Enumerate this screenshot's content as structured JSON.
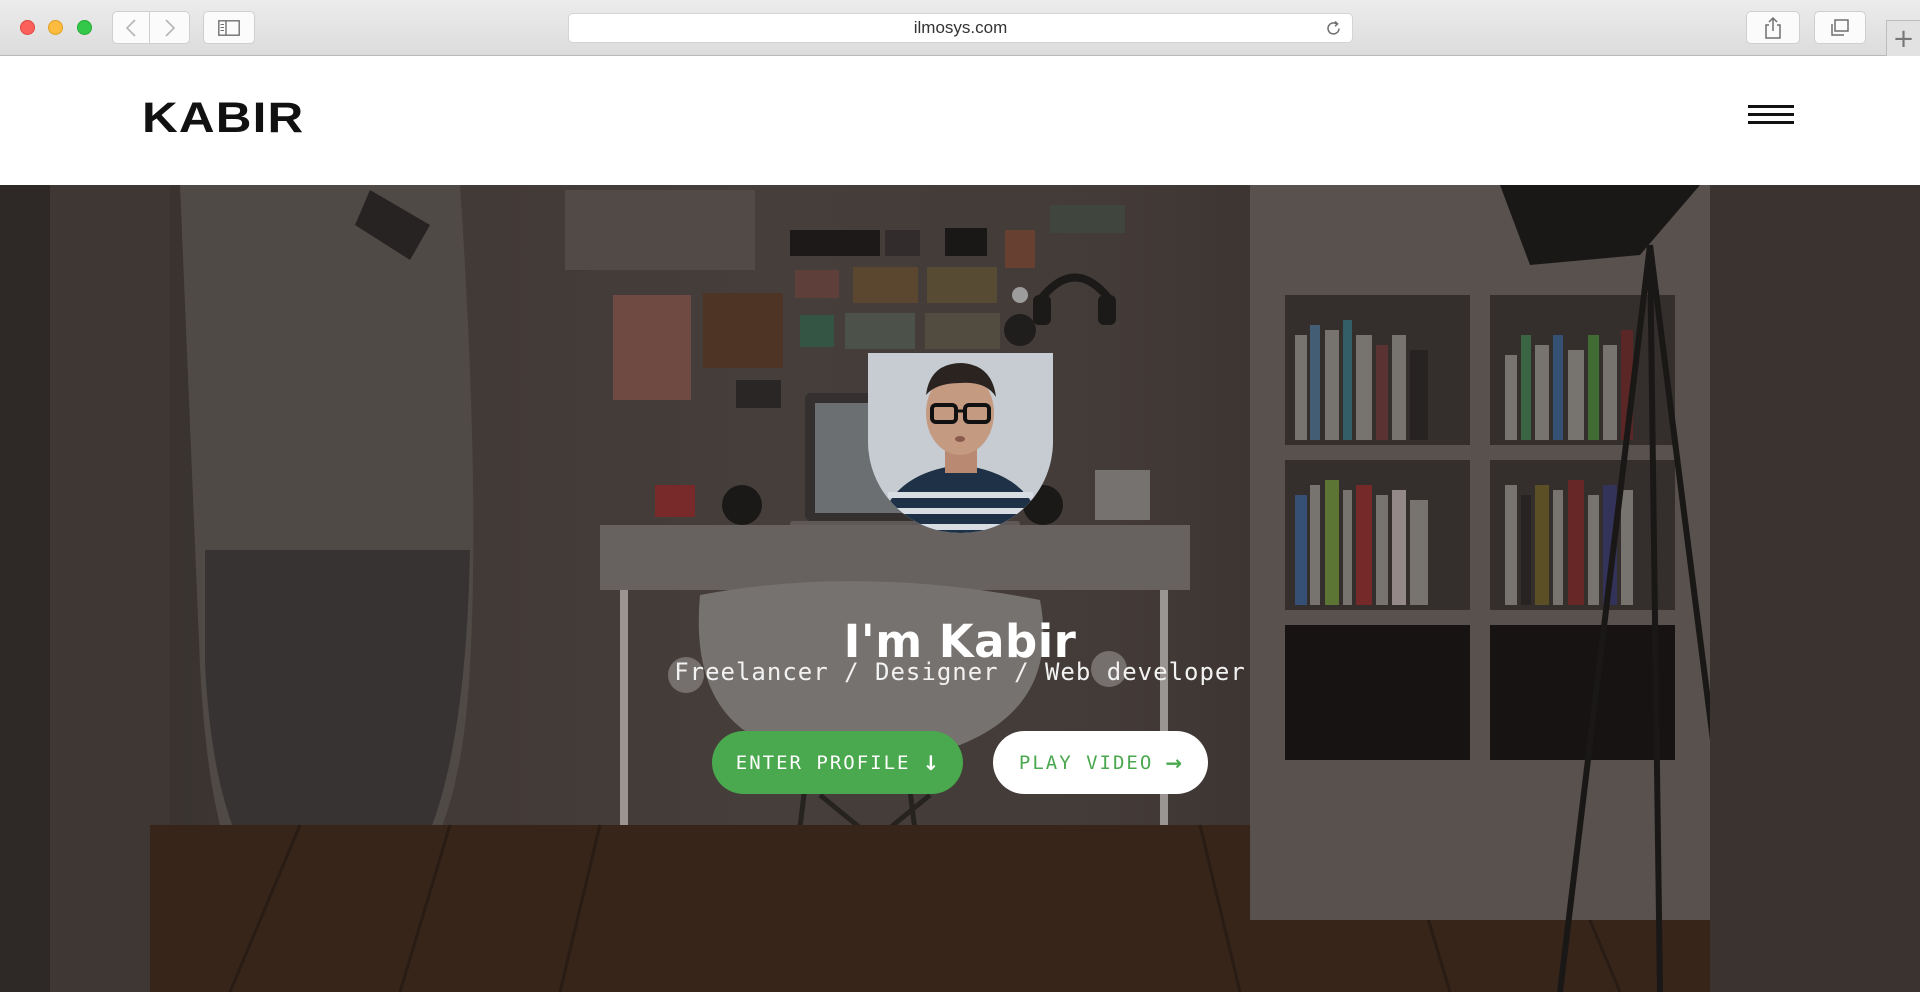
{
  "browser": {
    "url": "ilmosys.com"
  },
  "site": {
    "brand": "KABIR"
  },
  "hero": {
    "title": "I'm Kabir",
    "subtitle": "Freelancer / Designer / Web developer",
    "primary_button": {
      "label": "ENTER PROFILE",
      "icon": "arrow-down-icon"
    },
    "secondary_button": {
      "label": "PLAY VIDEO",
      "icon": "arrow-right-icon"
    }
  },
  "colors": {
    "accent": "#4aa84e",
    "header_bg": "#ffffff",
    "hero_overlay": "#3b3431"
  }
}
